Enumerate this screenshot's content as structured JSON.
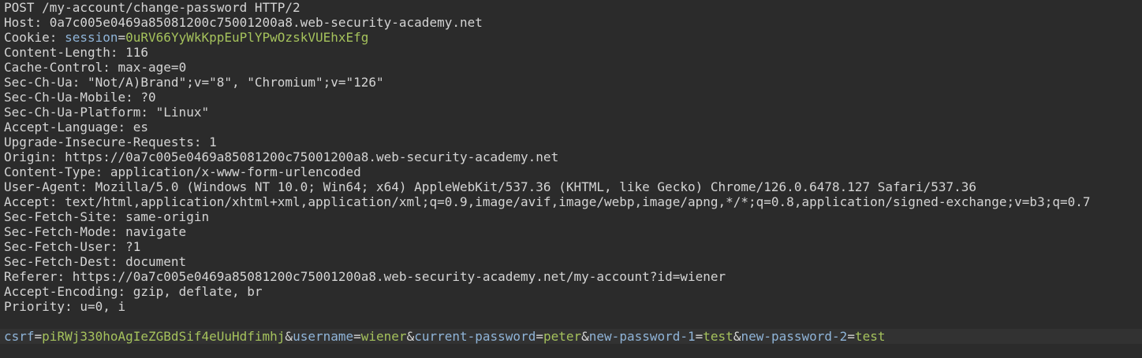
{
  "request_line": "POST /my-account/change-password HTTP/2",
  "headers": [
    {
      "name": "Host",
      "value": "0a7c005e0469a85081200c75001200a8.web-security-academy.net"
    },
    {
      "name": "Content-Length",
      "value": "116"
    },
    {
      "name": "Cache-Control",
      "value": "max-age=0"
    },
    {
      "name": "Sec-Ch-Ua",
      "value": "\"Not/A)Brand\";v=\"8\", \"Chromium\";v=\"126\""
    },
    {
      "name": "Sec-Ch-Ua-Mobile",
      "value": "?0"
    },
    {
      "name": "Sec-Ch-Ua-Platform",
      "value": "\"Linux\""
    },
    {
      "name": "Accept-Language",
      "value": "es"
    },
    {
      "name": "Upgrade-Insecure-Requests",
      "value": "1"
    },
    {
      "name": "Origin",
      "value": "https://0a7c005e0469a85081200c75001200a8.web-security-academy.net"
    },
    {
      "name": "Content-Type",
      "value": "application/x-www-form-urlencoded"
    },
    {
      "name": "User-Agent",
      "value": "Mozilla/5.0 (Windows NT 10.0; Win64; x64) AppleWebKit/537.36 (KHTML, like Gecko) Chrome/126.0.6478.127 Safari/537.36"
    },
    {
      "name": "Accept",
      "value": "text/html,application/xhtml+xml,application/xml;q=0.9,image/avif,image/webp,image/apng,*/*;q=0.8,application/signed-exchange;v=b3;q=0.7"
    },
    {
      "name": "Sec-Fetch-Site",
      "value": "same-origin"
    },
    {
      "name": "Sec-Fetch-Mode",
      "value": "navigate"
    },
    {
      "name": "Sec-Fetch-User",
      "value": "?1"
    },
    {
      "name": "Sec-Fetch-Dest",
      "value": "document"
    },
    {
      "name": "Referer",
      "value": "https://0a7c005e0469a85081200c75001200a8.web-security-academy.net/my-account?id=wiener"
    },
    {
      "name": "Accept-Encoding",
      "value": "gzip, deflate, br"
    },
    {
      "name": "Priority",
      "value": "u=0, i"
    }
  ],
  "cookie": {
    "header": "Cookie",
    "key": "session",
    "value": "0uRV66YyWkKppEuPlYPwOzskVUEhxEfg"
  },
  "body_params": [
    {
      "key": "csrf",
      "value": "piRWj330hoAgIeZGBdSif4eUuHdfimhj"
    },
    {
      "key": "username",
      "value": "wiener"
    },
    {
      "key": "current-password",
      "value": "peter"
    },
    {
      "key": "new-password-1",
      "value": "test"
    },
    {
      "key": "new-password-2",
      "value": "test"
    }
  ]
}
